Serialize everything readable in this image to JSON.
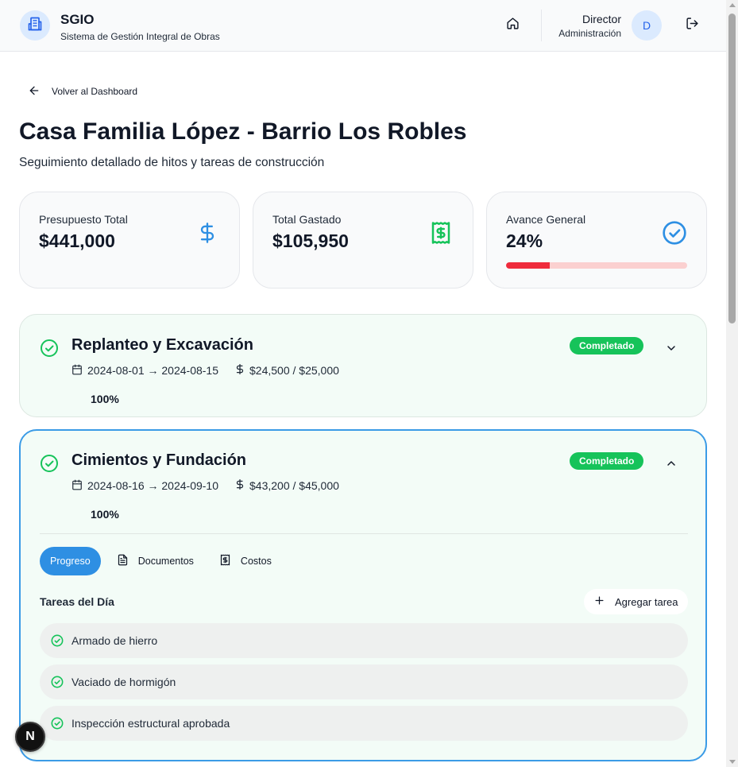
{
  "header": {
    "app_title": "SGIO",
    "app_subtitle": "Sistema de Gestión Integral de Obras",
    "user_role": "Director",
    "user_area": "Administración",
    "avatar_initial": "D",
    "icons": [
      "building-icon",
      "home-icon",
      "logout-icon"
    ]
  },
  "nav": {
    "back_label": "Volver al Dashboard"
  },
  "page": {
    "title": "Casa Familia López - Barrio Los Robles",
    "subtitle": "Seguimiento detallado de hitos y tareas de construcción"
  },
  "stats": [
    {
      "label": "Presupuesto Total",
      "value": "$441,000",
      "icon": "dollar-icon",
      "color": "#2e8fe3"
    },
    {
      "label": "Total Gastado",
      "value": "$105,950",
      "icon": "receipt-icon",
      "color": "#16c35a"
    },
    {
      "label": "Avance General",
      "value": "24%",
      "icon": "check-circle-icon",
      "color": "#2e8fe3",
      "progress": 0.24
    }
  ],
  "milestones": [
    {
      "title": "Replanteo y Excavación",
      "dates": "2024-08-01 → 2024-08-15",
      "cost": "$24,500 / $25,000",
      "percent": "100%",
      "status": "Completado",
      "expanded": false
    },
    {
      "title": "Cimientos y Fundación",
      "dates": "2024-08-16 → 2024-09-10",
      "cost": "$43,200 / $45,000",
      "percent": "100%",
      "status": "Completado",
      "expanded": true,
      "tabs": [
        "Progreso",
        "Documentos",
        "Costos"
      ],
      "active_tab": "Progreso",
      "tasks_heading": "Tareas del Día",
      "add_task_label": "Agregar tarea",
      "tasks": [
        "Armado de hierro",
        "Vaciado de hormigón",
        "Inspección estructural aprobada"
      ]
    }
  ],
  "floating": {
    "next_badge": "N"
  },
  "colors": {
    "accent": "#2e8fe3",
    "success": "#16c35a",
    "danger": "#ef2b3c",
    "card_bg": "#f9fafb",
    "milestone_bg": "#f3fcf7"
  }
}
